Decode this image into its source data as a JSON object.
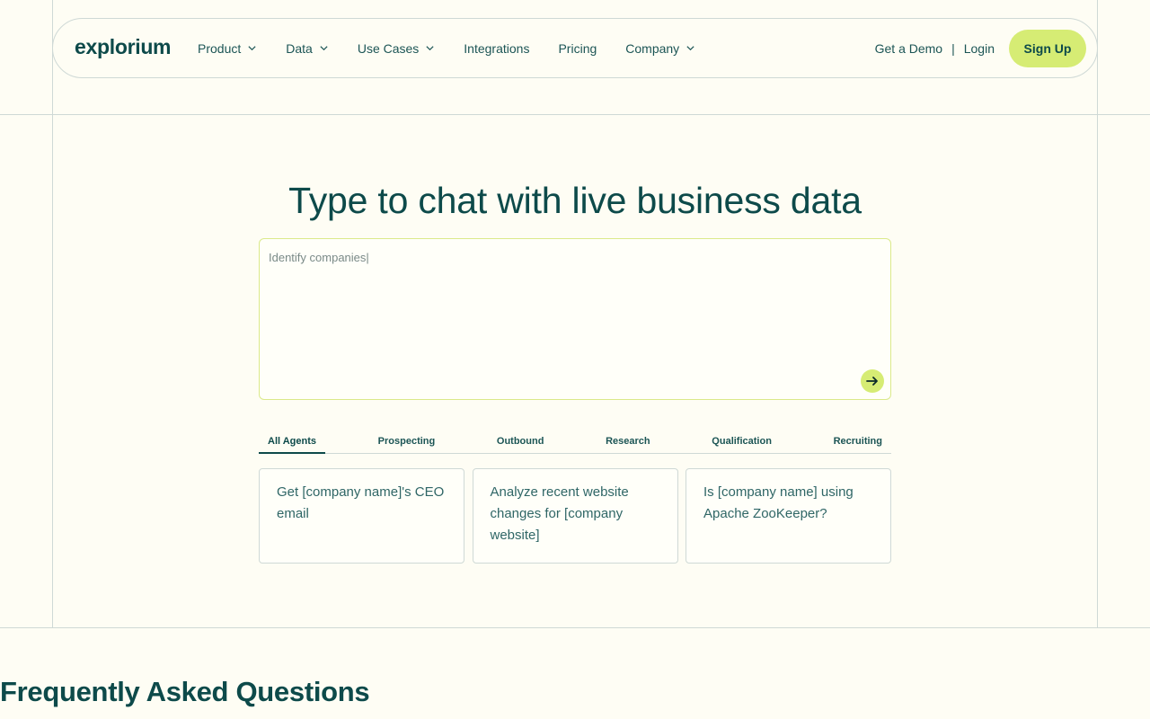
{
  "brand": {
    "logo_text": "explorium"
  },
  "nav": {
    "items": [
      {
        "label": "Product",
        "has_dropdown": true
      },
      {
        "label": "Data",
        "has_dropdown": true
      },
      {
        "label": "Use Cases",
        "has_dropdown": true
      },
      {
        "label": "Integrations",
        "has_dropdown": false
      },
      {
        "label": "Pricing",
        "has_dropdown": false
      },
      {
        "label": "Company",
        "has_dropdown": true
      }
    ],
    "demo_label": "Get a Demo",
    "separator": "|",
    "login_label": "Login",
    "signup_label": "Sign Up"
  },
  "hero": {
    "title": "Type to chat with live business data",
    "input_value": "Identify companies|",
    "send_icon": "arrow-right-icon"
  },
  "tabs": [
    {
      "label": "All Agents",
      "active": true
    },
    {
      "label": "Prospecting",
      "active": false
    },
    {
      "label": "Outbound",
      "active": false
    },
    {
      "label": "Research",
      "active": false
    },
    {
      "label": "Qualification",
      "active": false
    },
    {
      "label": "Recruiting",
      "active": false
    }
  ],
  "prompt_cards": [
    {
      "text": "Get [company name]'s CEO email"
    },
    {
      "text": "Analyze recent website changes for [company website]"
    },
    {
      "text": "Is [company name] using Apache ZooKeeper?"
    }
  ],
  "faq": {
    "title": "Frequently Asked Questions"
  },
  "colors": {
    "background": "#fefdf4",
    "primary_text": "#0d4a4a",
    "accent": "#d6ec74",
    "border": "#cfd9d6"
  }
}
